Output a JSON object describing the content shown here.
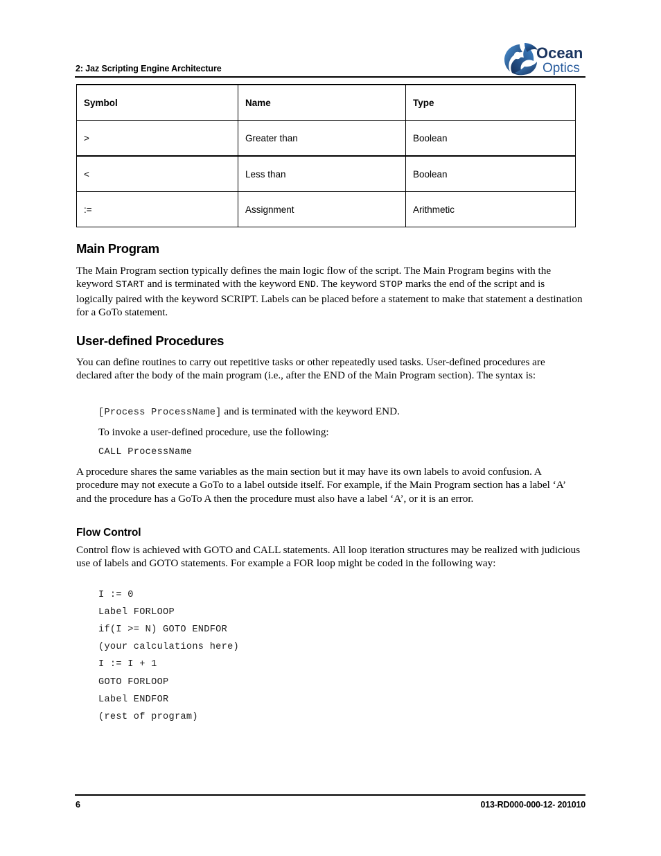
{
  "header": {
    "chapter_title": "2: Jaz Scripting Engine Architecture",
    "logo": {
      "name": "ocean-optics-logo",
      "word_top": "Ocean",
      "word_bottom": "Optics",
      "color_dark": "#1b3a6b",
      "color_mid": "#1f5fa8",
      "color_light": "#3f8fd2",
      "text_color": "#1b3560"
    }
  },
  "table": {
    "columns": [
      "Symbol",
      "Name",
      "Type"
    ],
    "rows": [
      {
        "symbol": ">",
        "name": "Greater than",
        "type": "Boolean"
      },
      {
        "symbol": "<",
        "name": "Less than",
        "type": "Boolean"
      },
      {
        "symbol": ":=",
        "name": "Assignment",
        "type": "Arithmetic"
      }
    ]
  },
  "sections": {
    "main_program": {
      "heading": "Main Program",
      "para_pre_start": "The Main Program section typically defines the main logic flow of the script. The Main Program begins with the keyword ",
      "kw_start": "START",
      "para_mid_1": " and is terminated with the keyword ",
      "kw_end": "END",
      "para_mid_2": ". The keyword ",
      "kw_stop": "STOP",
      "para_tail": " marks the end of the script and is logically paired with the keyword SCRIPT. Labels can be placed before a statement to make that statement a destination for a GoTo statement."
    },
    "user_defined_procedures": {
      "heading": "User-defined Procedures",
      "para_1": "You can define routines to carry out repetitive tasks or other repeatedly used tasks. User-defined procedures are declared after the body of the main program (i.e., after the END of the Main Program section). The syntax is:",
      "syntax_code": "[Process ProcessName]",
      "syntax_tail": " and is terminated with the keyword END.",
      "invoke_lead": "To invoke a user-defined procedure, use the following:",
      "invoke_code": "CALL ProcessName",
      "para_2": "A procedure shares the same variables as the main section but it may have its own labels to avoid confusion. A procedure may not execute a GoTo to a label outside itself. For example, if the Main Program section has a label ‘A’ and the procedure has a GoTo A then the procedure must also have a label ‘A’, or it is an error."
    },
    "flow_control": {
      "heading": "Flow Control",
      "para_1": "Control flow is achieved with GOTO and CALL statements. All loop iteration structures may be realized with judicious use of labels and GOTO statements. For example a FOR loop might be coded in the following way:",
      "code_lines": [
        "I := 0",
        "Label FORLOOP",
        "if(I >= N) GOTO ENDFOR",
        "(your calculations here)",
        "I := I + 1",
        "GOTO FORLOOP",
        "Label ENDFOR",
        "(rest of program)"
      ]
    }
  },
  "footer": {
    "page_number": "6",
    "document_id": "013-RD000-000-12- 201010"
  }
}
